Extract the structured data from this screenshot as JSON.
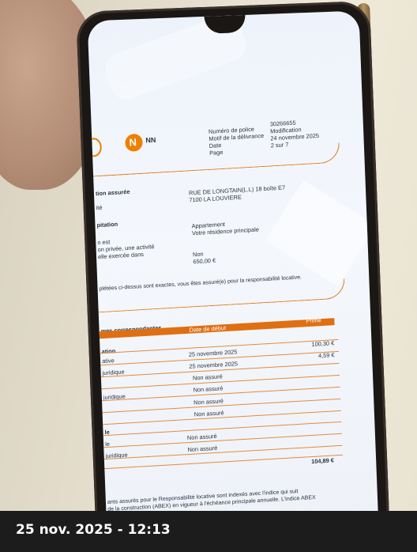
{
  "logo": {
    "brand": "NN"
  },
  "header": {
    "labels": [
      "Numéro de police",
      "Motif de la délivrance",
      "Date",
      "Page"
    ],
    "values": [
      "30266655",
      "Modification",
      "24 novembre 2025",
      "2 sur 7"
    ]
  },
  "situation": {
    "title": "tion assurée",
    "label": "ité",
    "address1": "RUE DE LONGTAIN(L.L) 18 boîte E7",
    "address2": "7100 LA LOUVIERE"
  },
  "habitation": {
    "title": "pitation",
    "line1": "Appartement",
    "line2": "Votre résidence principale",
    "q1": "n est",
    "q2": "on privée, une activité",
    "q3": "elle exercée dans",
    "a1": "Non",
    "a2": "650,00 €"
  },
  "note": "plétées ci-dessus sont exactes, vous êtes assuré(e) pour la responsabilité locative.",
  "table": {
    "title": "mes correspondantes",
    "col_start": "Date de début",
    "col_prime": "Prime",
    "group1": "ation",
    "rows": [
      {
        "label": "ative",
        "date": "25 novembre 2025",
        "prime": "100,30 €"
      },
      {
        "label": "juridique",
        "date": "25 novembre 2025",
        "prime": "4,59 €"
      },
      {
        "label": "",
        "date": "Non assuré",
        "prime": ""
      },
      {
        "label": "juridique",
        "date": "Non assuré",
        "prime": ""
      },
      {
        "label": "",
        "date": "Non assuré",
        "prime": ""
      },
      {
        "label": "",
        "date": "Non assuré",
        "prime": ""
      }
    ],
    "group2": "le",
    "rows2": [
      {
        "label": "le",
        "date": "Non assuré"
      },
      {
        "label": "juridique",
        "date": "Non assuré"
      }
    ],
    "total": "104,89 €"
  },
  "footer": {
    "line1": "ants assurés pour le Responsabilité locative sont indexés avec l'indice qui suit",
    "line2": "de la construction (ABEX) en vigueur à l'échéance principale annuelle. L'indice ABEX"
  },
  "caption": "25 nov. 2025 - 12:13",
  "colors": {
    "accent": "#e06f12",
    "brand": "#ee7f00"
  }
}
